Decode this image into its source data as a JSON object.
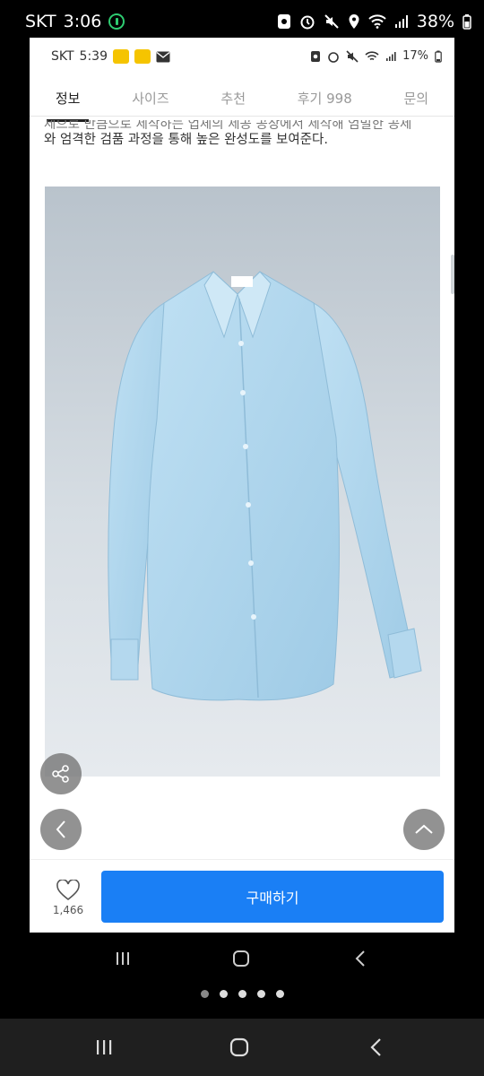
{
  "outer_status": {
    "carrier": "SKT",
    "time": "3:06",
    "battery": "38%"
  },
  "inner_status": {
    "carrier": "SKT",
    "time": "5:39",
    "battery": "17%"
  },
  "tabs": [
    {
      "label": "정보",
      "active": true
    },
    {
      "label": "사이즈",
      "active": false
    },
    {
      "label": "추천",
      "active": false
    },
    {
      "label": "후기 998",
      "active": false
    },
    {
      "label": "문의",
      "active": false
    }
  ],
  "description": {
    "line_cut": "제으로 만큼으로 제작하는 업체의 제공 공장에서 제작해 엄밀한 공제",
    "line": "와 엄격한 검품 과정을 통해 높은 완성도를 보여준다."
  },
  "product": {
    "likes": "1,466",
    "buy_label": "구매하기"
  },
  "icons": {
    "close": "close-icon",
    "share": "share-icon",
    "back": "chevron-left-icon",
    "top": "chevron-up-icon",
    "like": "heart-icon"
  },
  "colors": {
    "accent": "#1a7ff5",
    "charging": "#2ecc71"
  },
  "pager": {
    "count": 5,
    "active_index": 0
  }
}
